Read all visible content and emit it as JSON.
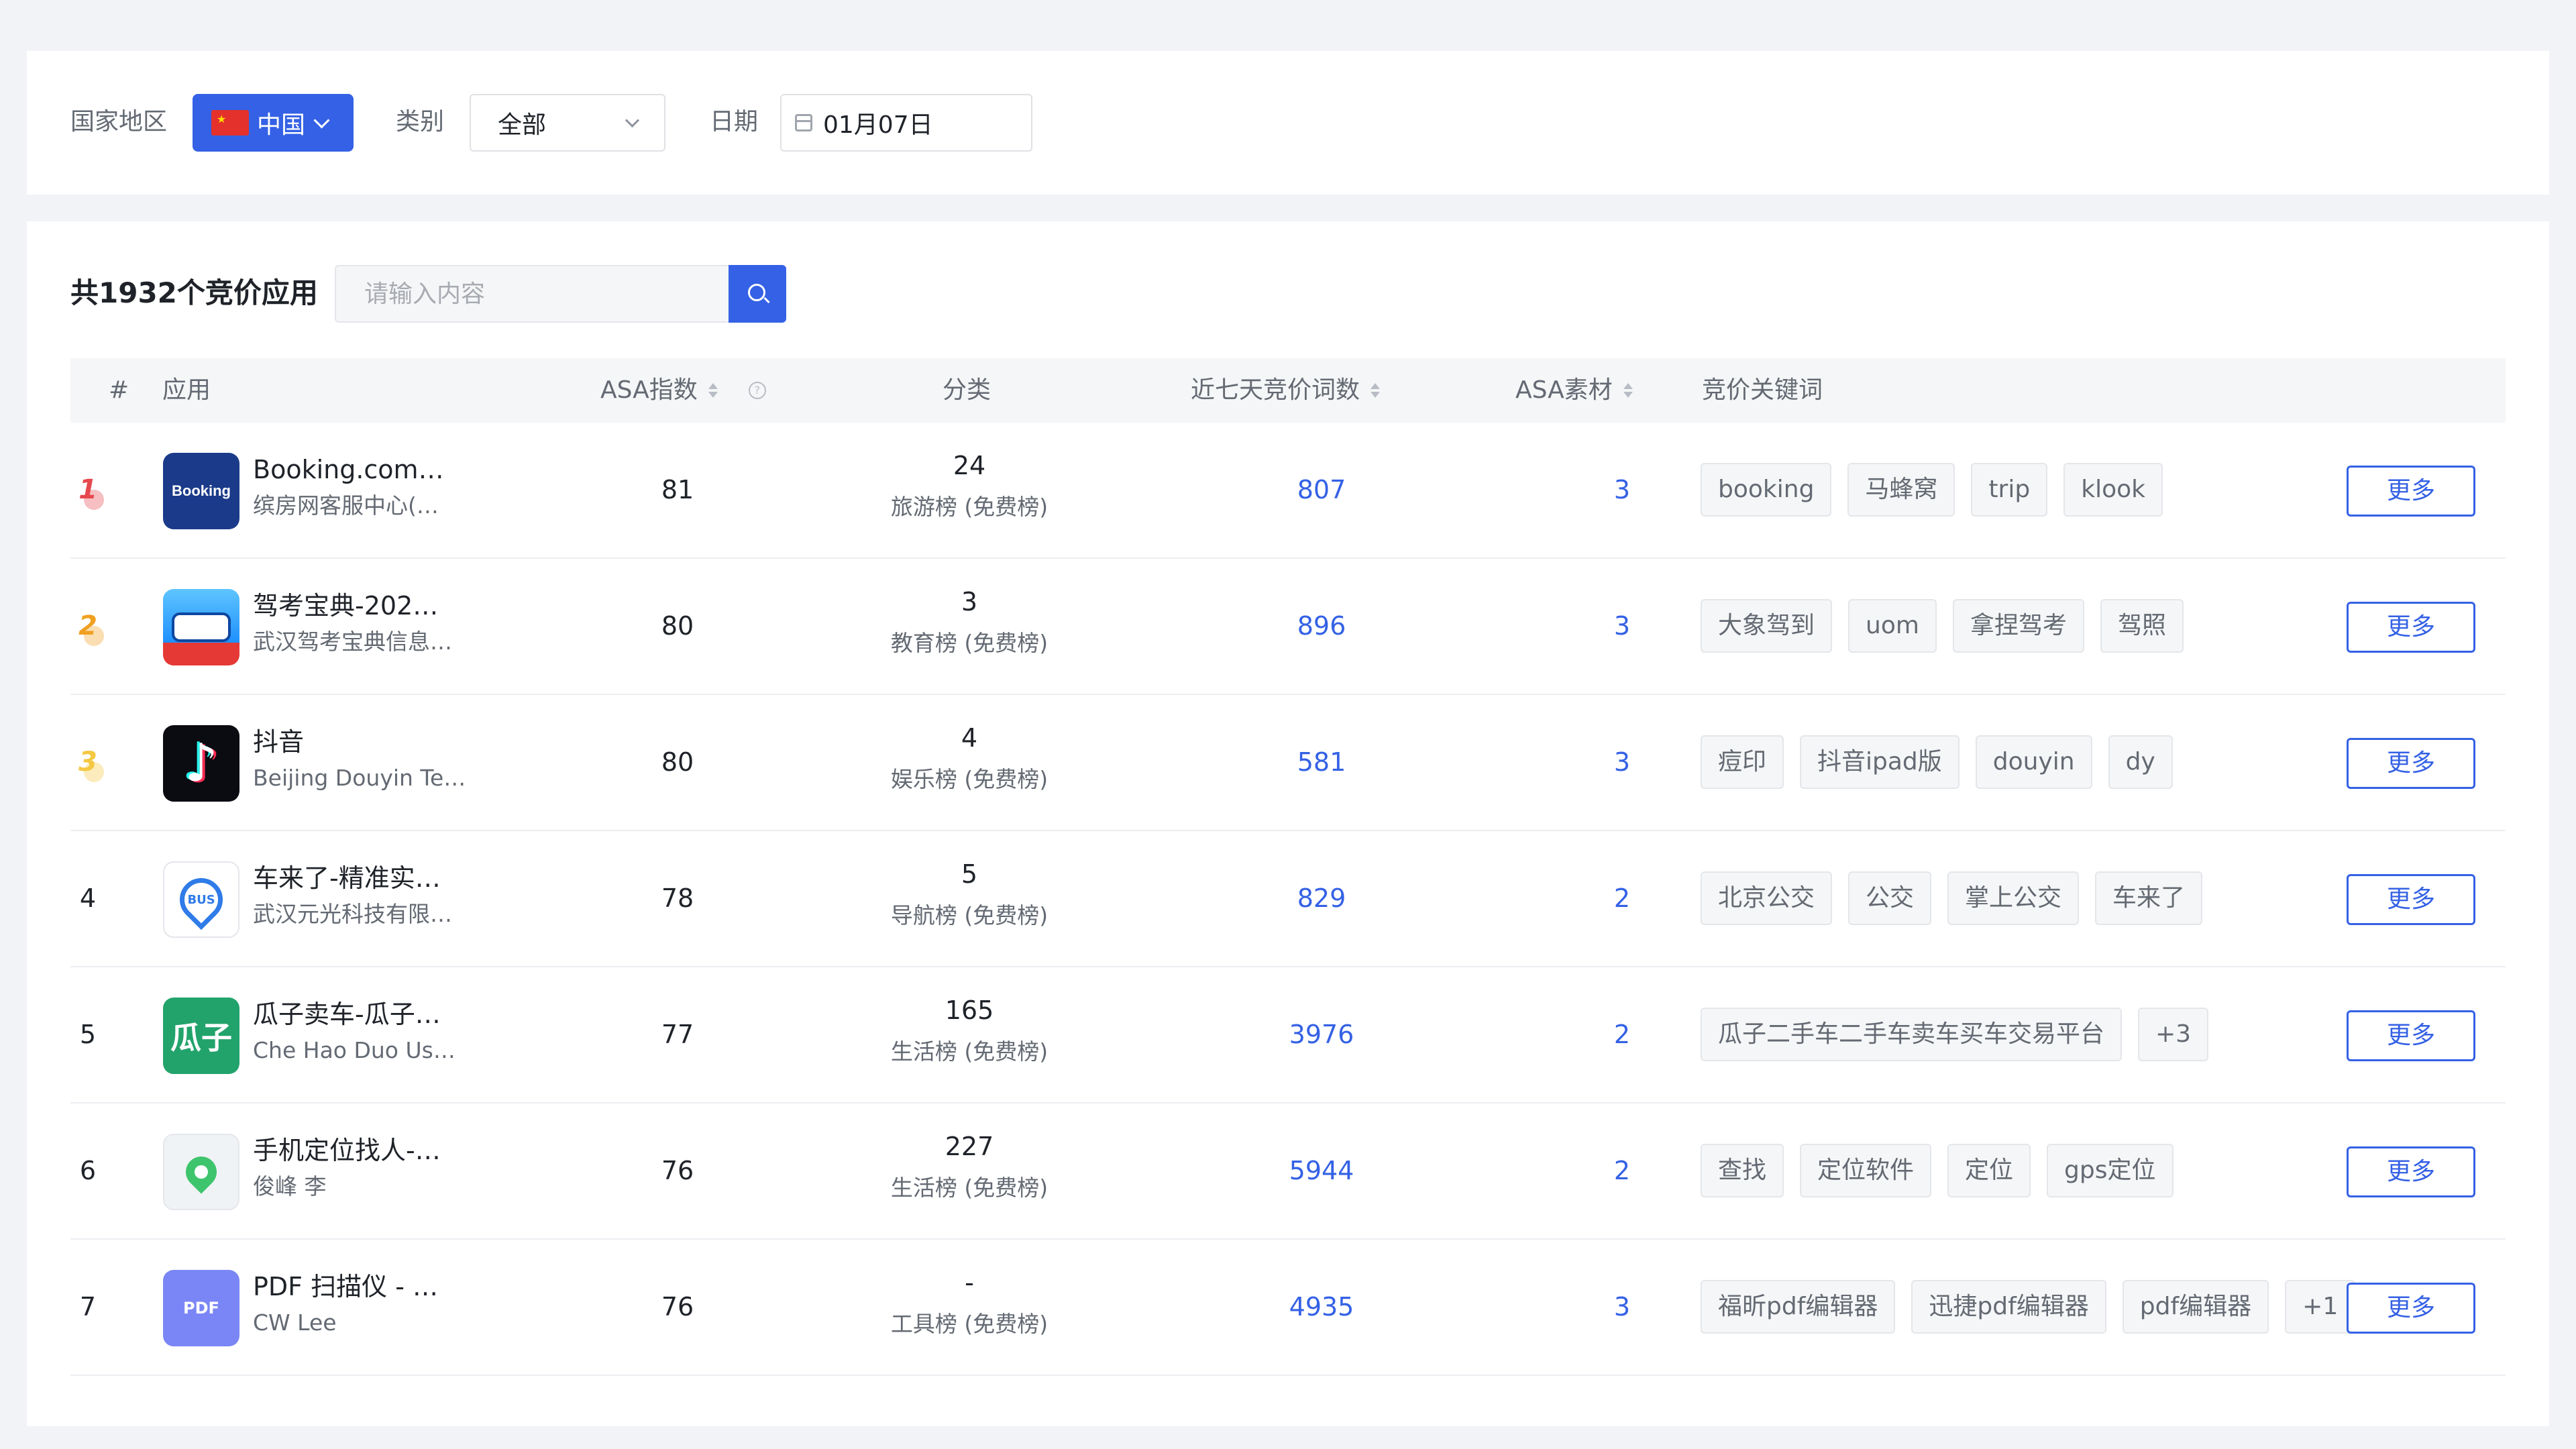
{
  "filters": {
    "country_label": "国家地区",
    "country_value": "中国",
    "category_label": "类别",
    "category_value": "全部",
    "date_label": "日期",
    "date_value": "01月07日"
  },
  "list": {
    "total_label": "共1932个竞价应用",
    "search_placeholder": "请输入内容"
  },
  "table": {
    "headers": {
      "rank": "#",
      "app": "应用",
      "asa_index": "ASA指数",
      "category": "分类",
      "keywords_7d": "近七天竞价词数",
      "asa_material": "ASA素材",
      "bid_keywords": "竞价关键词"
    },
    "more_label": "更多",
    "rows": [
      {
        "rank": "1",
        "name": "Booking.com…",
        "developer": "缤房网客服中心(…",
        "icon": "booking-logo",
        "icon_text": "Booking",
        "asa": "81",
        "cat_rank": "24",
        "cat_label": "旅游榜 (免费榜)",
        "kw_count": "807",
        "material": "3",
        "tags": [
          "booking",
          "马蜂窝",
          "trip",
          "klook"
        ]
      },
      {
        "rank": "2",
        "name": "驾考宝典-202…",
        "developer": "武汉驾考宝典信息…",
        "icon": "car-logo",
        "icon_text": "",
        "asa": "80",
        "cat_rank": "3",
        "cat_label": "教育榜 (免费榜)",
        "kw_count": "896",
        "material": "3",
        "tags": [
          "大象驾到",
          "uom",
          "拿捏驾考",
          "驾照"
        ]
      },
      {
        "rank": "3",
        "name": "抖音",
        "developer": "Beijing Douyin Te…",
        "icon": "tiktok-logo",
        "icon_text": "♪",
        "asa": "80",
        "cat_rank": "4",
        "cat_label": "娱乐榜 (免费榜)",
        "kw_count": "581",
        "material": "3",
        "tags": [
          "痘印",
          "抖音ipad版",
          "douyin",
          "dy"
        ]
      },
      {
        "rank": "4",
        "name": "车来了-精准实…",
        "developer": "武汉元光科技有限…",
        "icon": "bus-pin-logo",
        "icon_text": "BUS",
        "asa": "78",
        "cat_rank": "5",
        "cat_label": "导航榜 (免费榜)",
        "kw_count": "829",
        "material": "2",
        "tags": [
          "北京公交",
          "公交",
          "掌上公交",
          "车来了"
        ]
      },
      {
        "rank": "5",
        "name": "瓜子卖车-瓜子…",
        "developer": "Che Hao Duo Us…",
        "icon": "guazi-logo",
        "icon_text": "瓜子",
        "asa": "77",
        "cat_rank": "165",
        "cat_label": "生活榜 (免费榜)",
        "kw_count": "3976",
        "material": "2",
        "tags": [
          "瓜子二手车二手车卖车买车交易平台",
          "+3"
        ]
      },
      {
        "rank": "6",
        "name": "手机定位找人-…",
        "developer": "俊峰 李",
        "icon": "map-pin-logo",
        "icon_text": "",
        "asa": "76",
        "cat_rank": "227",
        "cat_label": "生活榜 (免费榜)",
        "kw_count": "5944",
        "material": "2",
        "tags": [
          "查找",
          "定位软件",
          "定位",
          "gps定位"
        ]
      },
      {
        "rank": "7",
        "name": "PDF 扫描仪 - …",
        "developer": "CW Lee",
        "icon": "pdf-scanner-logo",
        "icon_text": "PDF",
        "asa": "76",
        "cat_rank": "-",
        "cat_label": "工具榜 (免费榜)",
        "kw_count": "4935",
        "material": "3",
        "tags": [
          "福昕pdf编辑器",
          "迅捷pdf编辑器",
          "pdf编辑器",
          "+1"
        ]
      }
    ]
  },
  "colors": {
    "accent": "#3461e5",
    "gold": "#f0a020",
    "silver": "#f0b050",
    "bronze": "#f5c842",
    "first": "#e5484d"
  }
}
